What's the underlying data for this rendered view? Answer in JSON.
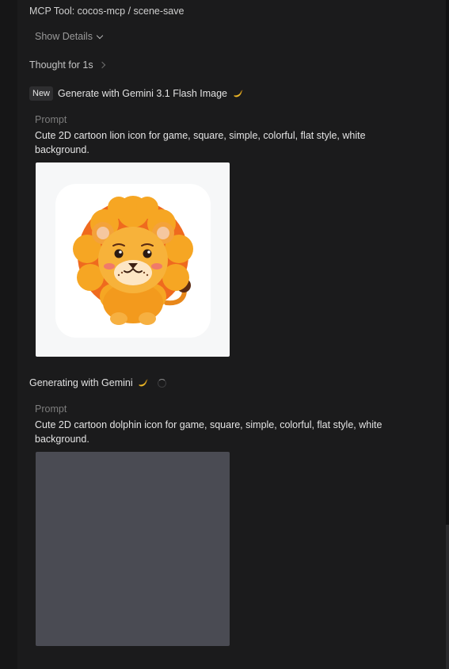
{
  "mcp_tool": {
    "title": "MCP Tool: cocos-mcp / scene-save"
  },
  "details": {
    "show_label": "Show Details"
  },
  "thought": {
    "label": "Thought for 1s"
  },
  "generation_1": {
    "badge": "New",
    "title": "Generate with Gemini 3.1 Flash Image",
    "title_icon": "banana-icon",
    "prompt_label": "Prompt",
    "prompt_text": "Cute 2D cartoon lion icon for game, square, simple, colorful, flat style, white background."
  },
  "generation_2": {
    "status": "Generating with Gemini",
    "status_icon": "banana-icon",
    "prompt_label": "Prompt",
    "prompt_text": "Cute 2D cartoon dolphin icon for game, square, simple, colorful, flat style, white background."
  },
  "colors": {
    "background": "#1b1b1c",
    "placeholder": "#4a4b53",
    "image_bg": "#f6f7f8",
    "lion_orange": "#f39a1d",
    "lion_mane": "#ef6a1e"
  }
}
